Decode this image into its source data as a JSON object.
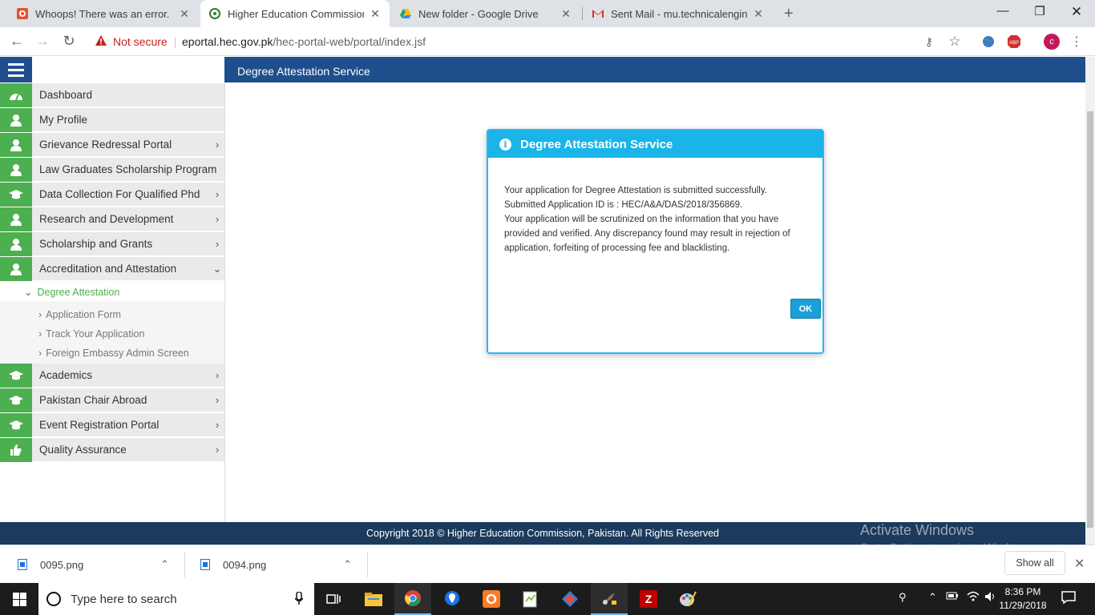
{
  "browser": {
    "tabs": [
      {
        "title": "Whoops! There was an error.",
        "icon": "error-favicon"
      },
      {
        "title": "Higher Education Commission Of",
        "icon": "hec-favicon"
      },
      {
        "title": "New folder - Google Drive",
        "icon": "drive-favicon"
      },
      {
        "title": "Sent Mail - mu.technicalengineer",
        "icon": "gmail-favicon"
      }
    ],
    "security_label": "Not secure",
    "url_domain": "eportal.hec.gov.pk",
    "url_path": "/hec-portal-web/portal/index.jsf",
    "profile_initial": "c",
    "abp_label": "ABP"
  },
  "page": {
    "header_title": "Degree Attestation Service",
    "footer": "Copyright 2018 © Higher Education Commission, Pakistan. All Rights Reserved"
  },
  "sidebar": {
    "items": [
      {
        "label": "Dashboard",
        "icon": "dashboard-icon",
        "chevron": ""
      },
      {
        "label": "My Profile",
        "icon": "user-icon",
        "chevron": ""
      },
      {
        "label": "Grievance Redressal Portal",
        "icon": "user-icon",
        "chevron": "›"
      },
      {
        "label": "Law Graduates Scholarship Program",
        "icon": "user-icon",
        "chevron": ""
      },
      {
        "label": "Data Collection For Qualified Phd",
        "icon": "graduation-cap-icon",
        "chevron": "›"
      },
      {
        "label": "Research and Development",
        "icon": "user-icon",
        "chevron": "›"
      },
      {
        "label": "Scholarship and Grants",
        "icon": "user-icon",
        "chevron": "›"
      },
      {
        "label": "Accreditation and Attestation",
        "icon": "user-icon",
        "chevron": "⌄"
      },
      {
        "label": "Academics",
        "icon": "graduation-cap-icon",
        "chevron": "›"
      },
      {
        "label": "Pakistan Chair Abroad",
        "icon": "graduation-cap-icon",
        "chevron": "›"
      },
      {
        "label": "Event Registration Portal",
        "icon": "graduation-cap-icon",
        "chevron": "›"
      },
      {
        "label": "Quality Assurance",
        "icon": "thumbs-up-icon",
        "chevron": "›"
      }
    ],
    "submenu_title": "Degree Attestation",
    "submenu_items": [
      "Application Form",
      "Track Your Application",
      "Foreign Embassy Admin Screen"
    ]
  },
  "dialog": {
    "title": "Degree Attestation Service",
    "line1": "Your application for Degree Attestation is submitted successfully.",
    "line2": "Submitted Application ID is : HEC/A&A/DAS/2018/356869.",
    "line3": "Your application will be scrutinized on the information that you have provided and verified. Any discrepancy found may result in rejection of application, forfeiting of processing fee and blacklisting.",
    "ok_label": "OK"
  },
  "watermark": {
    "title": "Activate Windows",
    "subtitle": "Go to Settings to activate Windows."
  },
  "downloads": {
    "files": [
      "0095.png",
      "0094.png"
    ],
    "show_all": "Show all"
  },
  "taskbar": {
    "search_placeholder": "Type here to search",
    "time": "8:36 PM",
    "date": "11/29/2018"
  }
}
